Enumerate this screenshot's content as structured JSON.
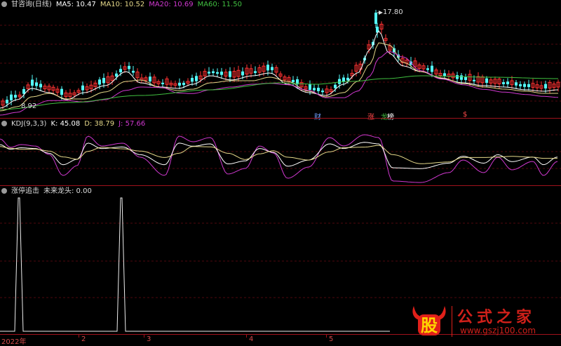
{
  "main": {
    "title": "甘咨询(日线)",
    "ma": [
      {
        "label": "MA5: 10.47",
        "color": "#ffffff"
      },
      {
        "label": "MA10: 10.52",
        "color": "#e6d98a"
      },
      {
        "label": "MA20: 10.69",
        "color": "#d038d0"
      },
      {
        "label": "MA60: 11.50",
        "color": "#40c040"
      }
    ],
    "high_label": "17.80",
    "low_label": "8.92",
    "tags": [
      {
        "text": "财",
        "color": "#6f9fff"
      },
      {
        "text": "涨",
        "color": "#ff4a4a"
      },
      {
        "text": "龙",
        "color": "#40c040"
      },
      {
        "text": "榜",
        "color": "#ffffff"
      },
      {
        "text": "$",
        "color": "#ff4a4a"
      }
    ]
  },
  "kdj": {
    "title": "KDJ(9,3,3)",
    "k": "K: 45.08",
    "d": "D: 38.79",
    "j": "J: 57.66"
  },
  "indicator": {
    "title": "涨停追击",
    "value": "未来龙头: 0.00"
  },
  "axis": {
    "labels": [
      "2022年",
      "2",
      "3",
      "4",
      "5"
    ]
  },
  "watermark": {
    "logo_char": "股",
    "name": "公式之家",
    "url": "www.gszj100.com"
  },
  "colors": {
    "up": "#ff3232",
    "down": "#54fcfc",
    "divider": "#a0121c",
    "k": "#ffffff",
    "d": "#e6d98a",
    "j": "#d038d0"
  }
}
